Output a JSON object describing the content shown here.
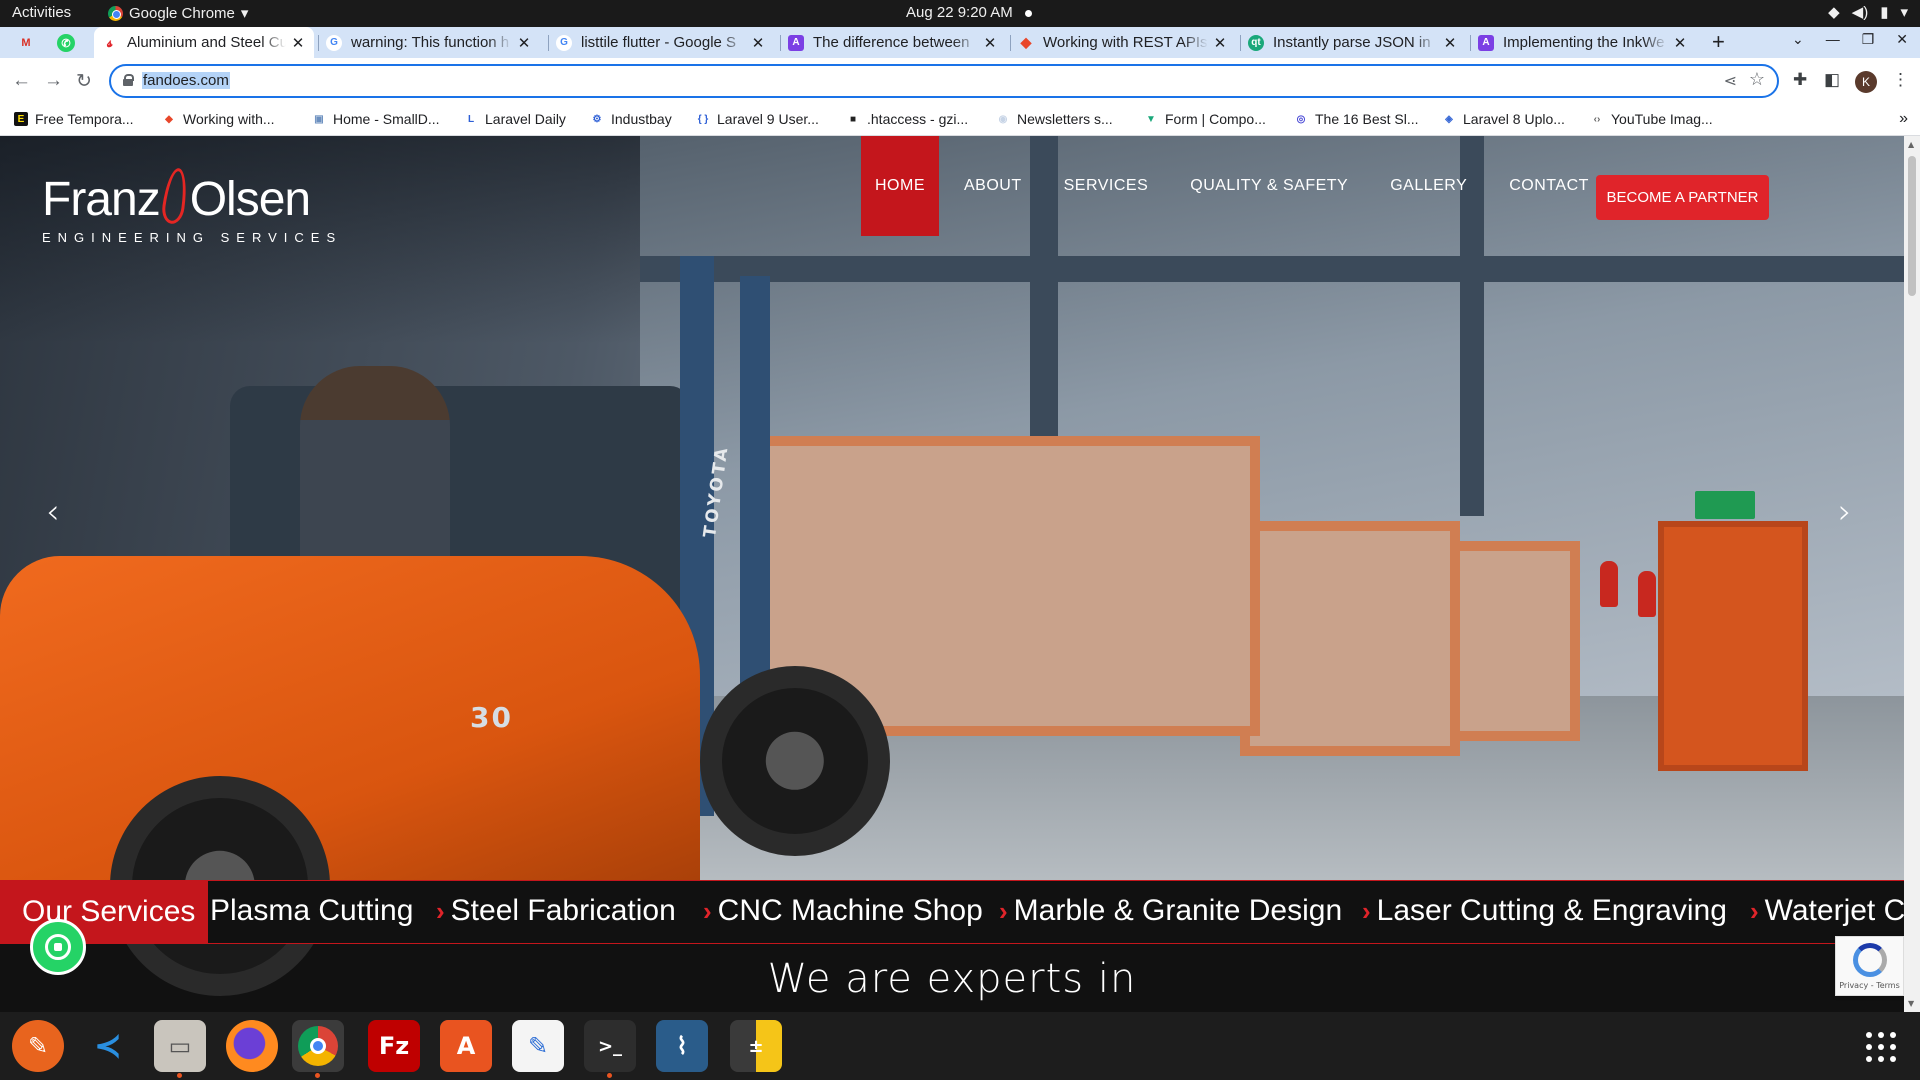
{
  "system_bar": {
    "activities": "Activities",
    "app": "Google Chrome",
    "clock": "Aug 22  9:20 AM"
  },
  "tabs": [
    {
      "title": "Aluminium and Steel Cut",
      "active": true
    },
    {
      "title": "warning: This function h"
    },
    {
      "title": "listtile flutter - Google S"
    },
    {
      "title": "The difference between"
    },
    {
      "title": "Working with REST APIs"
    },
    {
      "title": "Instantly parse JSON in"
    },
    {
      "title": "Implementing the InkWe"
    }
  ],
  "tab_colors": {
    "gmail": "#d93025",
    "whatsapp": "#25d366",
    "site": "#e0242a",
    "google": "#4285f4",
    "purple": "#7b3fe4",
    "red": "#e8472b",
    "quicktype": "#1aa87a"
  },
  "address_bar": {
    "url": "fandoes.com"
  },
  "bookmarks": [
    {
      "label": "Free Tempora...",
      "icon": "E"
    },
    {
      "label": "Working with...",
      "icon": "◆"
    },
    {
      "label": "Home - SmallD...",
      "icon": "▣"
    },
    {
      "label": "Laravel Daily",
      "icon": "L"
    },
    {
      "label": "Industbay",
      "icon": "⚙"
    },
    {
      "label": "Laravel 9 User...",
      "icon": "{ }"
    },
    {
      "label": ".htaccess - gzi...",
      "icon": "■"
    },
    {
      "label": "Newsletters s...",
      "icon": "◉"
    },
    {
      "label": "Form | Compo...",
      "icon": "▼"
    },
    {
      "label": "The 16 Best Sl...",
      "icon": "◎"
    },
    {
      "label": "Laravel 8 Uplo...",
      "icon": "◈"
    },
    {
      "label": "YouTube Imag...",
      "icon": "‹›"
    }
  ],
  "site": {
    "logo_name_1": "Franz",
    "logo_name_2": "Olsen",
    "logo_sub": "ENGINEERING SERVICES",
    "nav": [
      "HOME",
      "ABOUT",
      "SERVICES",
      "QUALITY & SAFETY",
      "GALLERY",
      "CONTACT"
    ],
    "cta": "BECOME A PARTNER",
    "hero_model": "30",
    "hero_brand": "TOYOTA",
    "services_label": "Our Services",
    "services": [
      "Plasma Cutting",
      "Steel Fabrication",
      "CNC Machine Shop",
      "Marble & Granite Design",
      "Laser Cutting & Engraving",
      "Waterjet C"
    ],
    "experts_heading": "We are experts in",
    "recaptcha_footer": "Privacy - Terms",
    "accent": "#c4161c"
  },
  "dock": [
    "inkscape",
    "vscode",
    "files",
    "firefox",
    "chrome",
    "filezilla",
    "software-center",
    "text-editor",
    "terminal",
    "mysql-workbench",
    "calculator"
  ]
}
